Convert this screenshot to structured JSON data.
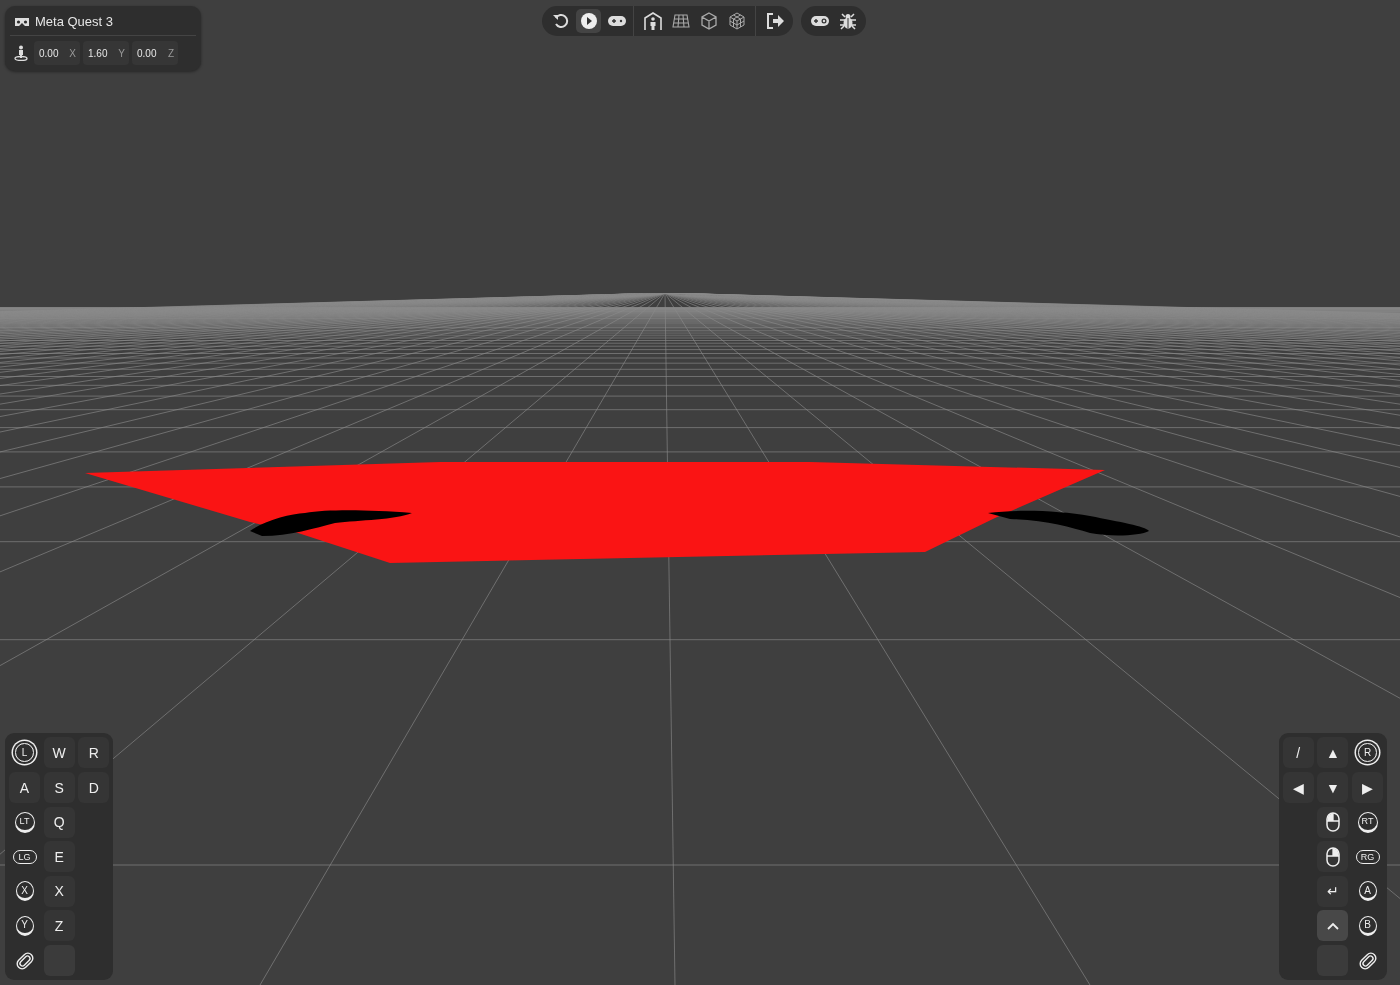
{
  "device_panel": {
    "title": "Meta Quest 3",
    "position": [
      {
        "value": "0.00",
        "axis": "X"
      },
      {
        "value": "1.60",
        "axis": "Y"
      },
      {
        "value": "0.00",
        "axis": "Z"
      }
    ]
  },
  "toolbar": {
    "groups": [
      [
        {
          "kind": "reset",
          "selected": false
        },
        {
          "kind": "play",
          "selected": true
        },
        {
          "kind": "gamepad",
          "selected": false
        }
      ],
      [
        {
          "kind": "room",
          "selected": false
        },
        {
          "kind": "plane",
          "selected": false
        },
        {
          "kind": "box",
          "selected": false
        },
        {
          "kind": "mesh",
          "selected": false
        }
      ],
      [
        {
          "kind": "exit",
          "selected": false
        }
      ],
      [
        {
          "kind": "gamepad-settings",
          "selected": false
        },
        {
          "kind": "bug",
          "selected": false
        }
      ]
    ]
  },
  "left_controls": [
    [
      {
        "kind": "stick",
        "label": "L"
      },
      {
        "kind": "key",
        "label": "W",
        "pressed": false
      },
      {
        "kind": "key",
        "label": "R",
        "pressed": false
      }
    ],
    [
      {
        "kind": "key",
        "label": "A",
        "pressed": false
      },
      {
        "kind": "key",
        "label": "S",
        "pressed": false
      },
      {
        "kind": "key",
        "label": "D",
        "pressed": false
      }
    ],
    [
      {
        "kind": "trigger",
        "label": "LT"
      },
      {
        "kind": "key",
        "label": "Q",
        "pressed": false
      },
      {
        "kind": "empty"
      }
    ],
    [
      {
        "kind": "grip",
        "label": "LG"
      },
      {
        "kind": "key",
        "label": "E",
        "pressed": false
      },
      {
        "kind": "empty"
      }
    ],
    [
      {
        "kind": "face",
        "label": "X"
      },
      {
        "kind": "key",
        "label": "X",
        "pressed": false
      },
      {
        "kind": "empty"
      }
    ],
    [
      {
        "kind": "face",
        "label": "Y"
      },
      {
        "kind": "key",
        "label": "Z",
        "pressed": false
      },
      {
        "kind": "empty"
      }
    ],
    [
      {
        "kind": "clip"
      },
      {
        "kind": "blank",
        "pressed": false
      },
      {
        "kind": "empty"
      }
    ]
  ],
  "right_controls": [
    [
      {
        "kind": "key",
        "label": "/",
        "pressed": false
      },
      {
        "kind": "key",
        "label": "▲",
        "pressed": false
      },
      {
        "kind": "stick",
        "label": "R"
      }
    ],
    [
      {
        "kind": "key",
        "label": "◀",
        "pressed": false
      },
      {
        "kind": "key",
        "label": "▼",
        "pressed": false
      },
      {
        "kind": "key",
        "label": "▶",
        "pressed": false
      }
    ],
    [
      {
        "kind": "empty"
      },
      {
        "kind": "mouse-left",
        "pressed": false
      },
      {
        "kind": "trigger",
        "label": "RT"
      }
    ],
    [
      {
        "kind": "empty"
      },
      {
        "kind": "mouse-right",
        "pressed": false
      },
      {
        "kind": "grip",
        "label": "RG"
      }
    ],
    [
      {
        "kind": "empty"
      },
      {
        "kind": "key",
        "label": "↵",
        "pressed": false
      },
      {
        "kind": "face",
        "label": "A"
      }
    ],
    [
      {
        "kind": "empty"
      },
      {
        "kind": "chevron",
        "pressed": true
      },
      {
        "kind": "face",
        "label": "B"
      }
    ],
    [
      {
        "kind": "empty"
      },
      {
        "kind": "blank",
        "pressed": false
      },
      {
        "kind": "clip"
      }
    ]
  ]
}
